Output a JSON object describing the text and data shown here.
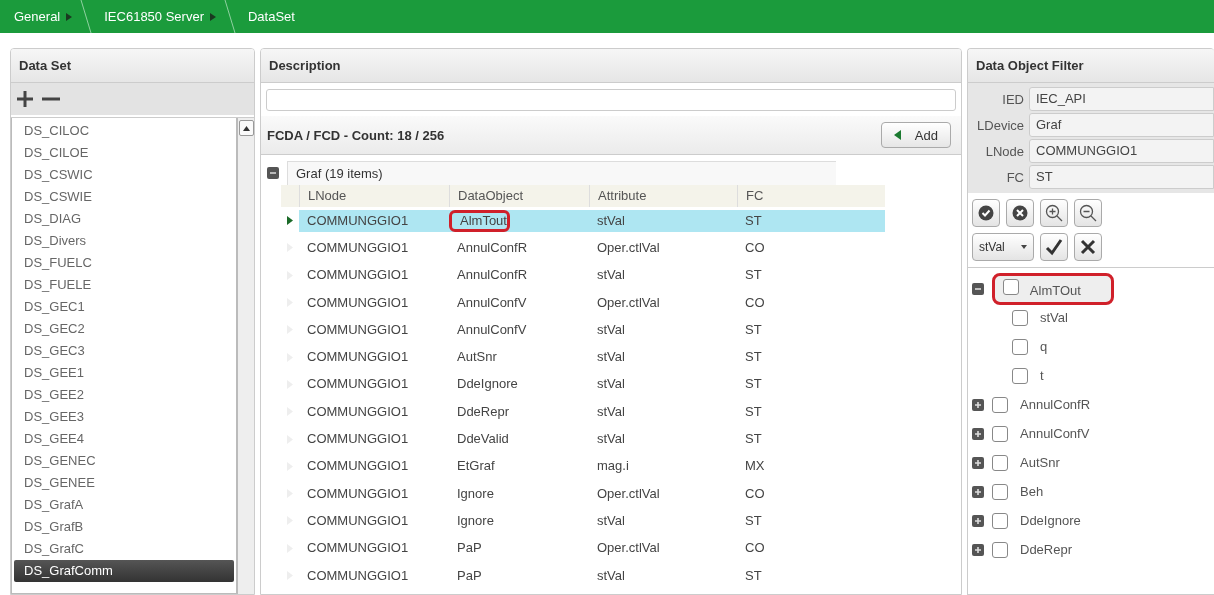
{
  "breadcrumb": [
    {
      "label": "General"
    },
    {
      "label": "IEC61850 Server"
    },
    {
      "label": "DataSet"
    }
  ],
  "dataset_panel": {
    "title": "Data Set",
    "items": [
      {
        "label": "DS_CILOC",
        "selected": false
      },
      {
        "label": "DS_CILOE",
        "selected": false
      },
      {
        "label": "DS_CSWIC",
        "selected": false
      },
      {
        "label": "DS_CSWIE",
        "selected": false
      },
      {
        "label": "DS_DIAG",
        "selected": false
      },
      {
        "label": "DS_Divers",
        "selected": false
      },
      {
        "label": "DS_FUELC",
        "selected": false
      },
      {
        "label": "DS_FUELE",
        "selected": false
      },
      {
        "label": "DS_GEC1",
        "selected": false
      },
      {
        "label": "DS_GEC2",
        "selected": false
      },
      {
        "label": "DS_GEC3",
        "selected": false
      },
      {
        "label": "DS_GEE1",
        "selected": false
      },
      {
        "label": "DS_GEE2",
        "selected": false
      },
      {
        "label": "DS_GEE3",
        "selected": false
      },
      {
        "label": "DS_GEE4",
        "selected": false
      },
      {
        "label": "DS_GENEC",
        "selected": false
      },
      {
        "label": "DS_GENEE",
        "selected": false
      },
      {
        "label": "DS_GrafA",
        "selected": false
      },
      {
        "label": "DS_GrafB",
        "selected": false
      },
      {
        "label": "DS_GrafC",
        "selected": false
      },
      {
        "label": "DS_GrafComm",
        "selected": true
      }
    ]
  },
  "description_panel": {
    "title": "Description"
  },
  "fcda": {
    "count_label": "FCDA / FCD - Count: 18 / 256",
    "add_button": "Add",
    "group": {
      "label": "Graf (19 items)",
      "expanded": true
    },
    "columns": [
      "LNode",
      "DataObject",
      "Attribute",
      "FC"
    ],
    "rows": [
      {
        "cells": [
          "COMMUNGGIO1",
          "AlmTout",
          "stVal",
          "ST"
        ],
        "selected": true,
        "circled": true
      },
      {
        "cells": [
          "COMMUNGGIO1",
          "AnnulConfR",
          "Oper.ctlVal",
          "CO"
        ],
        "selected": false,
        "circled": false
      },
      {
        "cells": [
          "COMMUNGGIO1",
          "AnnulConfR",
          "stVal",
          "ST"
        ],
        "selected": false,
        "circled": false
      },
      {
        "cells": [
          "COMMUNGGIO1",
          "AnnulConfV",
          "Oper.ctlVal",
          "CO"
        ],
        "selected": false,
        "circled": false
      },
      {
        "cells": [
          "COMMUNGGIO1",
          "AnnulConfV",
          "stVal",
          "ST"
        ],
        "selected": false,
        "circled": false
      },
      {
        "cells": [
          "COMMUNGGIO1",
          "AutSnr",
          "stVal",
          "ST"
        ],
        "selected": false,
        "circled": false
      },
      {
        "cells": [
          "COMMUNGGIO1",
          "DdeIgnore",
          "stVal",
          "ST"
        ],
        "selected": false,
        "circled": false
      },
      {
        "cells": [
          "COMMUNGGIO1",
          "DdeRepr",
          "stVal",
          "ST"
        ],
        "selected": false,
        "circled": false
      },
      {
        "cells": [
          "COMMUNGGIO1",
          "DdeValid",
          "stVal",
          "ST"
        ],
        "selected": false,
        "circled": false
      },
      {
        "cells": [
          "COMMUNGGIO1",
          "EtGraf",
          "mag.i",
          "MX"
        ],
        "selected": false,
        "circled": false
      },
      {
        "cells": [
          "COMMUNGGIO1",
          "Ignore",
          "Oper.ctlVal",
          "CO"
        ],
        "selected": false,
        "circled": false
      },
      {
        "cells": [
          "COMMUNGGIO1",
          "Ignore",
          "stVal",
          "ST"
        ],
        "selected": false,
        "circled": false
      },
      {
        "cells": [
          "COMMUNGGIO1",
          "PaP",
          "Oper.ctlVal",
          "CO"
        ],
        "selected": false,
        "circled": false
      },
      {
        "cells": [
          "COMMUNGGIO1",
          "PaP",
          "stVal",
          "ST"
        ],
        "selected": false,
        "circled": false
      }
    ]
  },
  "filter_panel": {
    "title": "Data Object Filter",
    "fields": [
      {
        "label": "IED",
        "value": "IEC_API"
      },
      {
        "label": "LDevice",
        "value": "Graf"
      },
      {
        "label": "LNode",
        "value": "COMMUNGGIO1"
      },
      {
        "label": "FC",
        "value": "ST"
      }
    ],
    "attribute_select": {
      "value": "stVal"
    },
    "tree": [
      {
        "label": "AlmTOut",
        "expanded": true,
        "checked": false,
        "circled": true,
        "children": [
          {
            "label": "stVal",
            "checked": false
          },
          {
            "label": "q",
            "checked": false
          },
          {
            "label": "t",
            "checked": false
          }
        ]
      },
      {
        "label": "AnnulConfR",
        "expanded": false,
        "checked": false,
        "circled": false
      },
      {
        "label": "AnnulConfV",
        "expanded": false,
        "checked": false,
        "circled": false
      },
      {
        "label": "AutSnr",
        "expanded": false,
        "checked": false,
        "circled": false
      },
      {
        "label": "Beh",
        "expanded": false,
        "checked": false,
        "circled": false
      },
      {
        "label": "DdeIgnore",
        "expanded": false,
        "checked": false,
        "circled": false
      },
      {
        "label": "DdeRepr",
        "expanded": false,
        "checked": false,
        "circled": false
      }
    ]
  }
}
